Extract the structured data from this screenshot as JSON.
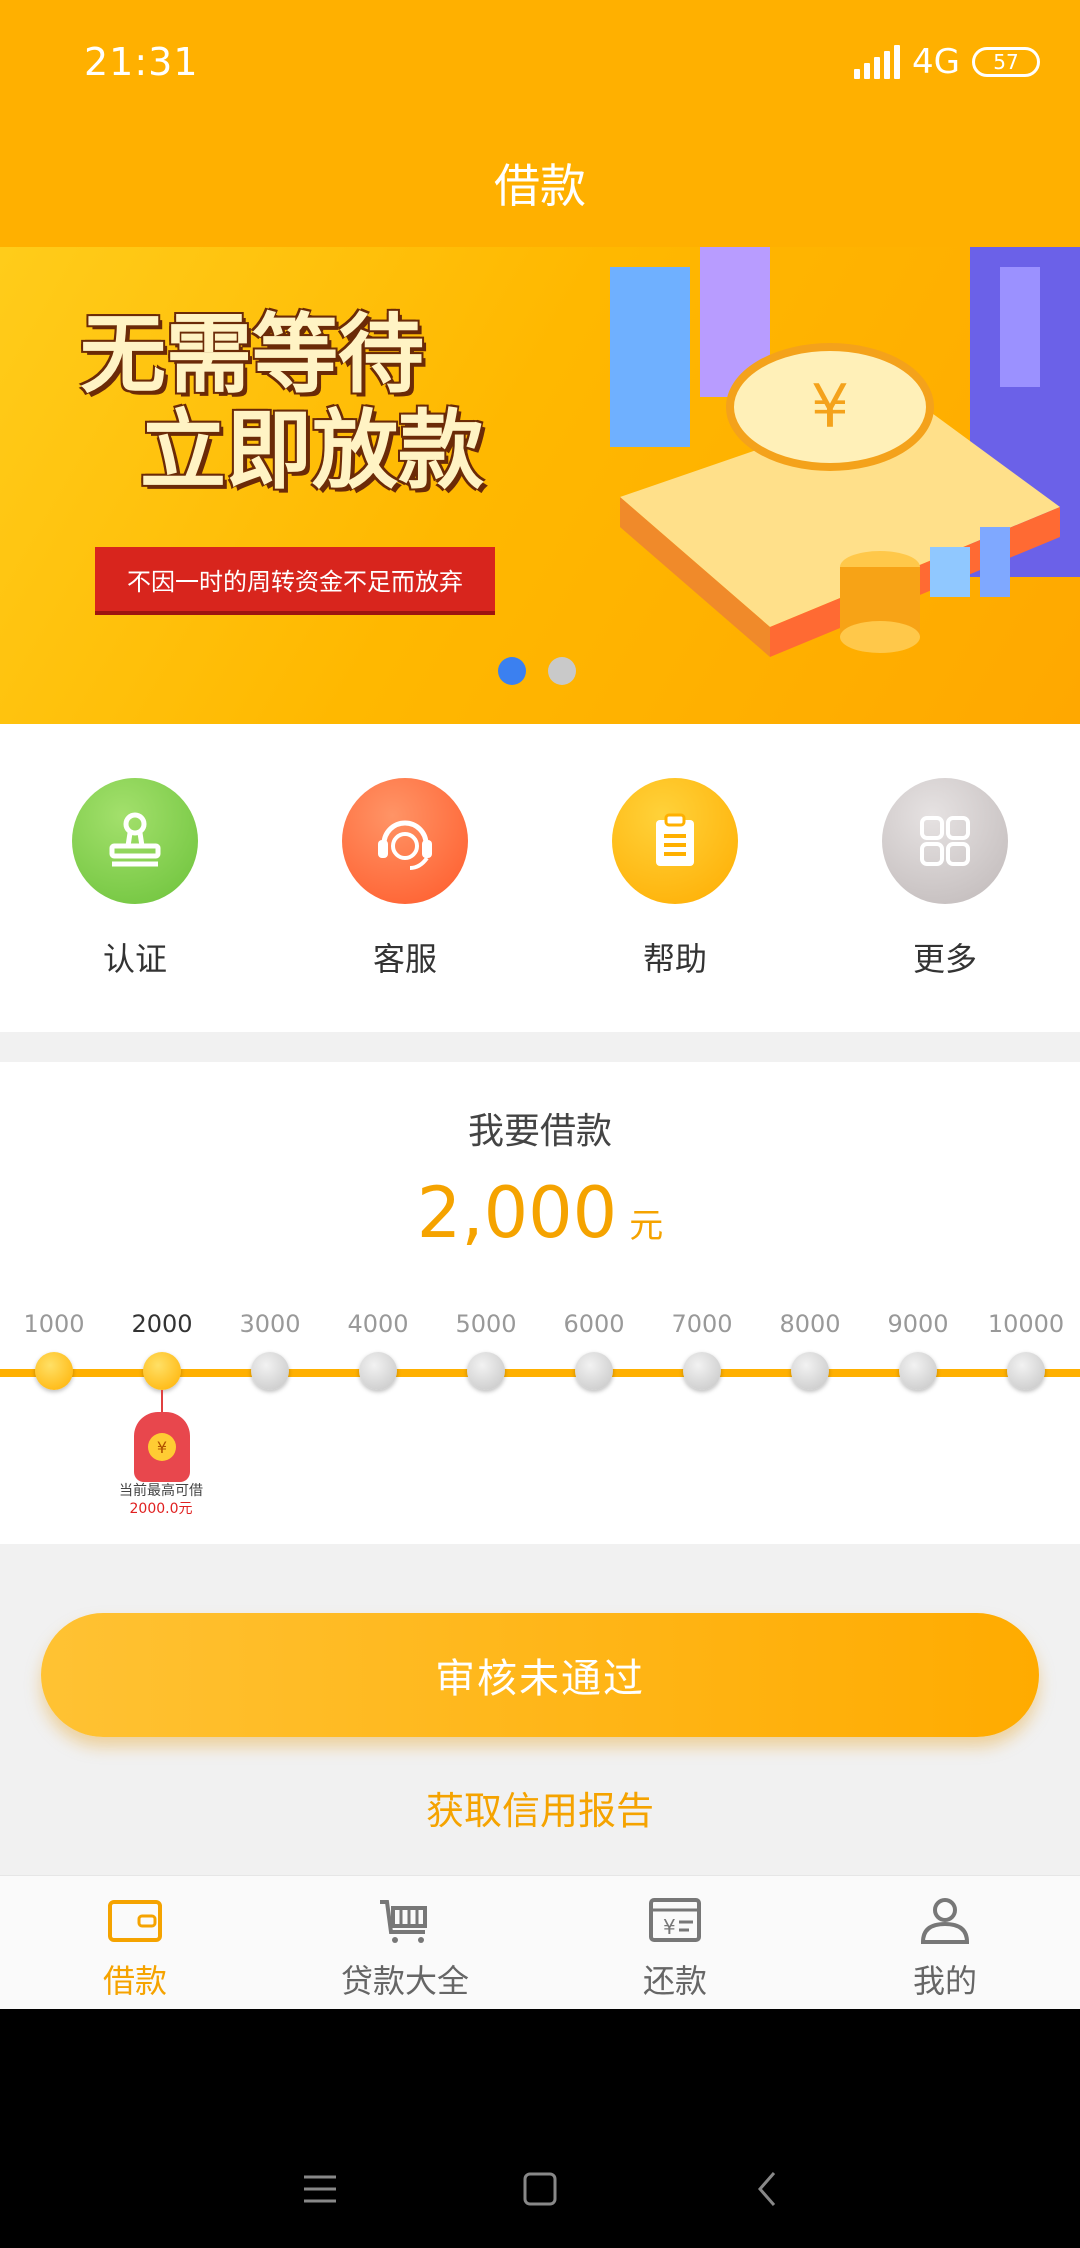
{
  "status_bar": {
    "time": "21:31",
    "network": "4G",
    "battery": "57"
  },
  "header": {
    "title": "借款"
  },
  "banner": {
    "headline_line1": "无需等待",
    "headline_line2": "立即放款",
    "ribbon_text": "不因一时的周转资金不足而放弃",
    "slides": 2,
    "active_slide": 1
  },
  "quick_menu": [
    {
      "label": "认证",
      "icon": "stamp-icon",
      "color": "#7ed04a"
    },
    {
      "label": "客服",
      "icon": "headset-icon",
      "color": "#ff6b3b"
    },
    {
      "label": "帮助",
      "icon": "clipboard-icon",
      "color": "#ffb300"
    },
    {
      "label": "更多",
      "icon": "grid-icon",
      "color": "#cfcaca"
    }
  ],
  "loan": {
    "title": "我要借款",
    "amount": "2,000",
    "unit": "元",
    "ticks": [
      "1000",
      "2000",
      "3000",
      "4000",
      "5000",
      "6000",
      "7000",
      "8000",
      "9000",
      "10000"
    ],
    "selected_index": 1,
    "max_line1": "当前最高可借",
    "max_line2": "2000.0元"
  },
  "actions": {
    "status_button": "审核未通过",
    "credit_link": "获取信用报告"
  },
  "tabbar": [
    {
      "label": "借款",
      "icon": "wallet-icon",
      "active": true
    },
    {
      "label": "贷款大全",
      "icon": "cart-icon",
      "active": false
    },
    {
      "label": "还款",
      "icon": "bill-icon",
      "active": false
    },
    {
      "label": "我的",
      "icon": "user-icon",
      "active": false
    }
  ],
  "colors": {
    "accent": "#ffb000",
    "accent_text": "#f5a300"
  }
}
